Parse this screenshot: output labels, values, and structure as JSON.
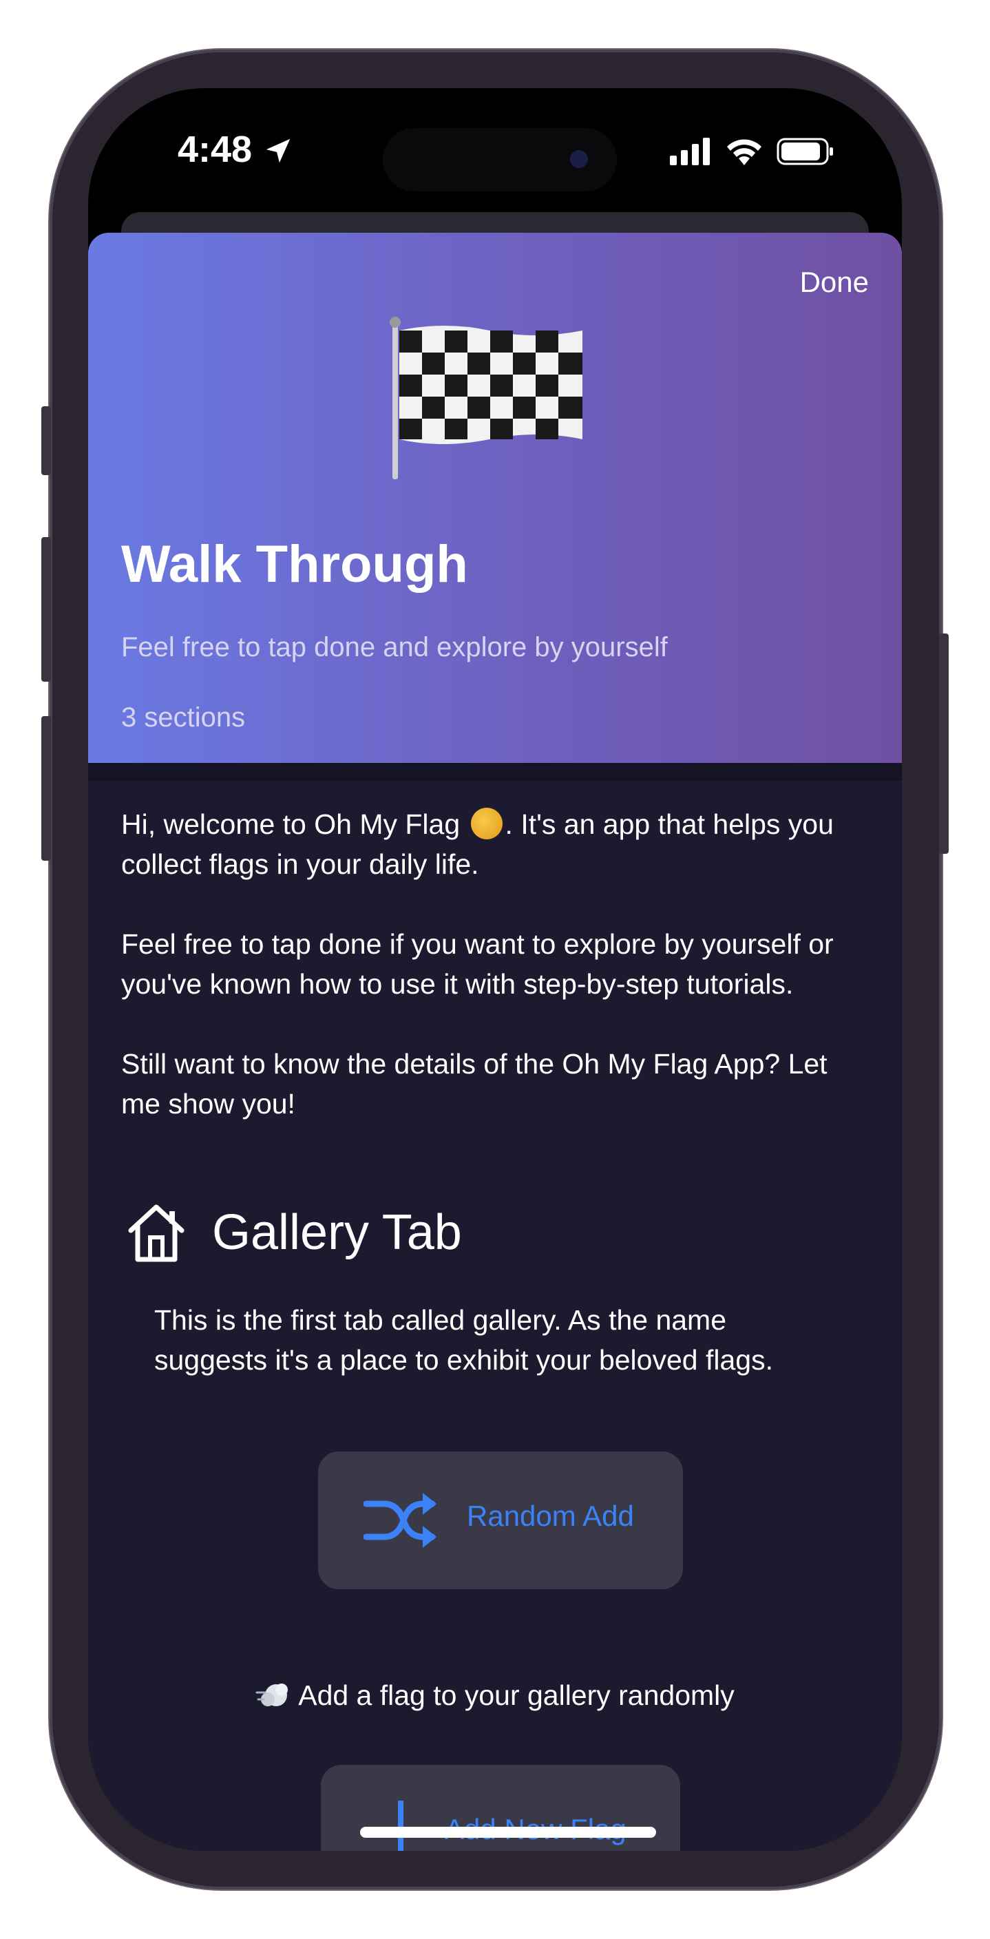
{
  "status_bar": {
    "time": "4:48",
    "icons": [
      "location-arrow-icon",
      "cellular-signal-icon",
      "wifi-icon",
      "battery-icon"
    ]
  },
  "sheet": {
    "done_label": "Done",
    "hero": {
      "icon": "checkered-flag-icon",
      "title": "Walk Through",
      "subtitle": "Feel free to tap done and explore by yourself",
      "sections_count": "3 sections",
      "gradient_colors": [
        "#6a7ae3",
        "#6f50a3"
      ]
    },
    "intro": {
      "para1_before": "Hi, welcome to Oh My Flag ",
      "para1_after": ". It's an app that helps you collect flags in your daily life.",
      "para2": "Feel free to tap done if you want to explore by yourself or you've known how to use it with step-by-step tutorials.",
      "para3": "Still want to know the details of the Oh My Flag App? Let me show you!"
    },
    "gallery_section": {
      "icon": "house-icon",
      "title": "Gallery Tab",
      "description": "This is the first tab called gallery. As the name suggests it's a place to exhibit your beloved flags.",
      "random_add_button": {
        "icon": "shuffle-icon",
        "label": "Random Add"
      },
      "random_add_caption": "Add a flag to your gallery randomly",
      "add_new_flag_button": {
        "icon": "plus-icon",
        "label": "Add New Flag"
      }
    }
  },
  "colors": {
    "accent": "#3b82f6",
    "background": "#1b1a2f",
    "button_bg": "#3a3948"
  }
}
